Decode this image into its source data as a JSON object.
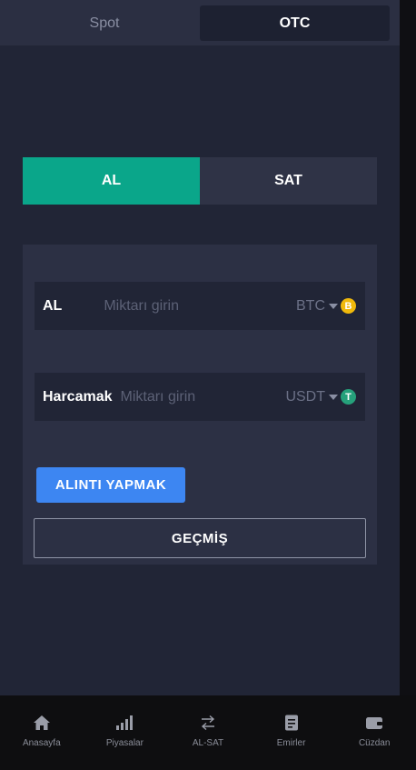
{
  "top_tabs": [
    {
      "label": "Spot",
      "active": false
    },
    {
      "label": "OTC",
      "active": true
    }
  ],
  "trade_toggle": {
    "buy_label": "AL",
    "sell_label": "SAT",
    "selected": "AL"
  },
  "form": {
    "buy_field": {
      "label": "AL",
      "value": "",
      "placeholder": "Miktarı girin",
      "currency": "BTC",
      "currency_icon": "btc-coin-icon"
    },
    "spend_field": {
      "label": "Harcamak",
      "value": "",
      "placeholder": "Miktarı girin",
      "currency": "USDT",
      "currency_icon": "usdt-coin-icon"
    },
    "quote_button": "ALINTI YAPMAK",
    "history_button": "GEÇMİŞ"
  },
  "bottom_nav": [
    {
      "label": "Anasayfa",
      "icon": "home-icon"
    },
    {
      "label": "Piyasalar",
      "icon": "signal-bars-icon"
    },
    {
      "label": "AL-SAT",
      "icon": "swap-arrows-icon"
    },
    {
      "label": "Emirler",
      "icon": "document-icon"
    },
    {
      "label": "Cüzdan",
      "icon": "wallet-icon"
    }
  ],
  "colors": {
    "background": "#212536",
    "panel": "#2c3044",
    "buy_accent": "#0aa68a",
    "primary_button": "#3d86f2",
    "btc": "#f0b90b",
    "usdt": "#26a17b"
  }
}
